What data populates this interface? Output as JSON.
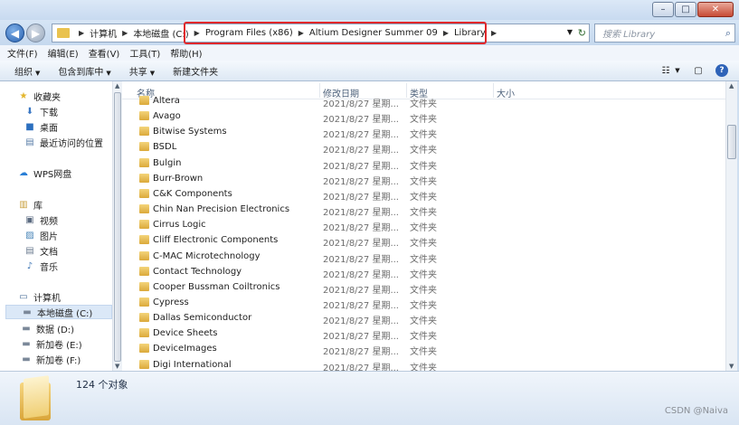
{
  "window": {
    "minimize": "–",
    "maximize": "□",
    "close": "✕"
  },
  "address": {
    "breadcrumbs": [
      "计算机",
      "本地磁盘 (C:)",
      "Program Files (x86)",
      "Altium Designer Summer 09",
      "Library"
    ],
    "search_placeholder": "搜索 Library"
  },
  "menu": [
    "文件(F)",
    "编辑(E)",
    "查看(V)",
    "工具(T)",
    "帮助(H)"
  ],
  "toolbar": {
    "organize": "组织",
    "include_in_library": "包含到库中",
    "share": "共享",
    "new_folder": "新建文件夹"
  },
  "nav": {
    "favorites": "收藏夹",
    "downloads": "下载",
    "desktop": "桌面",
    "recent": "最近访问的位置",
    "wps": "WPS网盘",
    "libraries": "库",
    "videos": "视频",
    "pictures": "图片",
    "documents": "文档",
    "music": "音乐",
    "computer": "计算机",
    "drive_c": "本地磁盘 (C:)",
    "drive_d": "数据 (D:)",
    "drive_e": "新加卷 (E:)",
    "drive_f": "新加卷 (F:)"
  },
  "columns": {
    "name": "名称",
    "date": "修改日期",
    "type": "类型",
    "size": "大小"
  },
  "files": [
    {
      "name": "Altera",
      "date": "2021/8/27 星期...",
      "type": "文件夹"
    },
    {
      "name": "Avago",
      "date": "2021/8/27 星期...",
      "type": "文件夹"
    },
    {
      "name": "Bitwise Systems",
      "date": "2021/8/27 星期...",
      "type": "文件夹"
    },
    {
      "name": "BSDL",
      "date": "2021/8/27 星期...",
      "type": "文件夹"
    },
    {
      "name": "Bulgin",
      "date": "2021/8/27 星期...",
      "type": "文件夹"
    },
    {
      "name": "Burr-Brown",
      "date": "2021/8/27 星期...",
      "type": "文件夹"
    },
    {
      "name": "C&K Components",
      "date": "2021/8/27 星期...",
      "type": "文件夹"
    },
    {
      "name": "Chin Nan Precision Electronics",
      "date": "2021/8/27 星期...",
      "type": "文件夹"
    },
    {
      "name": "Cirrus Logic",
      "date": "2021/8/27 星期...",
      "type": "文件夹"
    },
    {
      "name": "Cliff Electronic Components",
      "date": "2021/8/27 星期...",
      "type": "文件夹"
    },
    {
      "name": "C-MAC Microtechnology",
      "date": "2021/8/27 星期...",
      "type": "文件夹"
    },
    {
      "name": "Contact Technology",
      "date": "2021/8/27 星期...",
      "type": "文件夹"
    },
    {
      "name": "Cooper Bussman Coiltronics",
      "date": "2021/8/27 星期...",
      "type": "文件夹"
    },
    {
      "name": "Cypress",
      "date": "2021/8/27 星期...",
      "type": "文件夹"
    },
    {
      "name": "Dallas Semiconductor",
      "date": "2021/8/27 星期...",
      "type": "文件夹"
    },
    {
      "name": "Device Sheets",
      "date": "2021/8/27 星期...",
      "type": "文件夹"
    },
    {
      "name": "DeviceImages",
      "date": "2021/8/27 星期...",
      "type": "文件夹"
    },
    {
      "name": "Digi International",
      "date": "2021/8/27 星期...",
      "type": "文件夹"
    }
  ],
  "status": {
    "count": "124 个对象"
  },
  "watermark": "CSDN @Naiva"
}
